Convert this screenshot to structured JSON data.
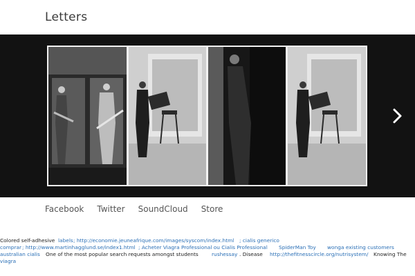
{
  "site": {
    "title": "Letters"
  },
  "slider": {
    "next_arrow_icon": "chevron-right-icon",
    "slides": [
      {
        "description": "band-members-with-guitars"
      },
      {
        "description": "man-holding-sign-by-chair"
      },
      {
        "description": "man-leaning-in-doorway"
      },
      {
        "description": "man-holding-sign-by-chair-repeat"
      }
    ]
  },
  "nav": {
    "items": [
      "Facebook",
      "Twitter",
      "SoundCloud",
      "Store"
    ]
  },
  "footer_text": {
    "line1": {
      "t1": "Colored self-adhesive",
      "l1": "labels",
      "l2": "; http://economie.jeuneafrique.com/images/syscom/index.html",
      "l3": "; cialis generico"
    },
    "line2": {
      "l1": "comprar",
      "l2": "; http://www.martinhagglund.se/index1.html",
      "l3": "; Acheter Viagra Professional ou Cialis Professional",
      "l4": "SpiderMan Toy",
      "l5": "wonga existing customers"
    },
    "line3": {
      "l1": "australian cialis",
      "t1": "One of the most popular search requests amongst students",
      "l2": "rushessay",
      "t2": ". Disease",
      "l3": "http://thefitnesscircle.org/nutrisystem/",
      "t3": "Knowing The"
    },
    "line4": {
      "l1": "viagra"
    }
  }
}
